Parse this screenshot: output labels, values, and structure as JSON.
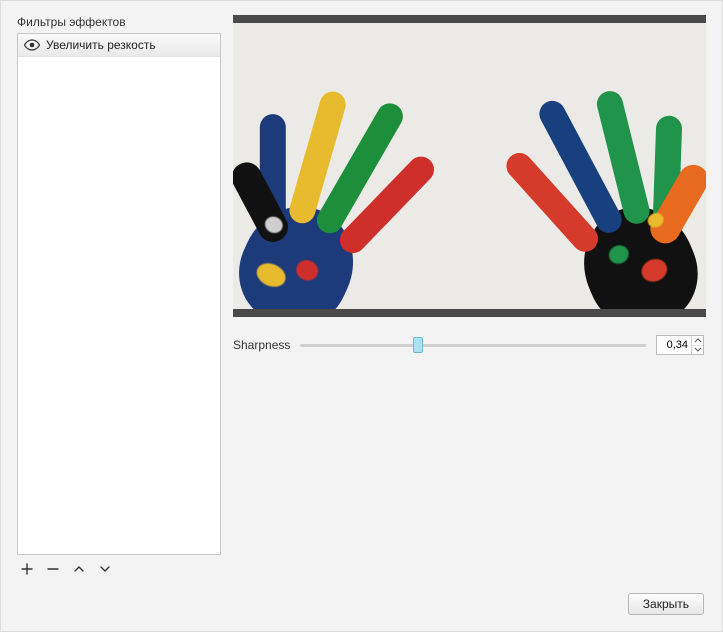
{
  "sidebar": {
    "title": "Фильтры эффектов",
    "filters": [
      {
        "label": "Увеличить резкость",
        "visible": true
      }
    ]
  },
  "param": {
    "label": "Sharpness",
    "value": "0,34",
    "position_percent": 34
  },
  "footer": {
    "close_label": "Закрыть"
  },
  "icons": {
    "add": "plus-icon",
    "remove": "minus-icon",
    "up": "chevron-up-icon",
    "down": "chevron-down-icon",
    "visibility": "eye-icon"
  }
}
